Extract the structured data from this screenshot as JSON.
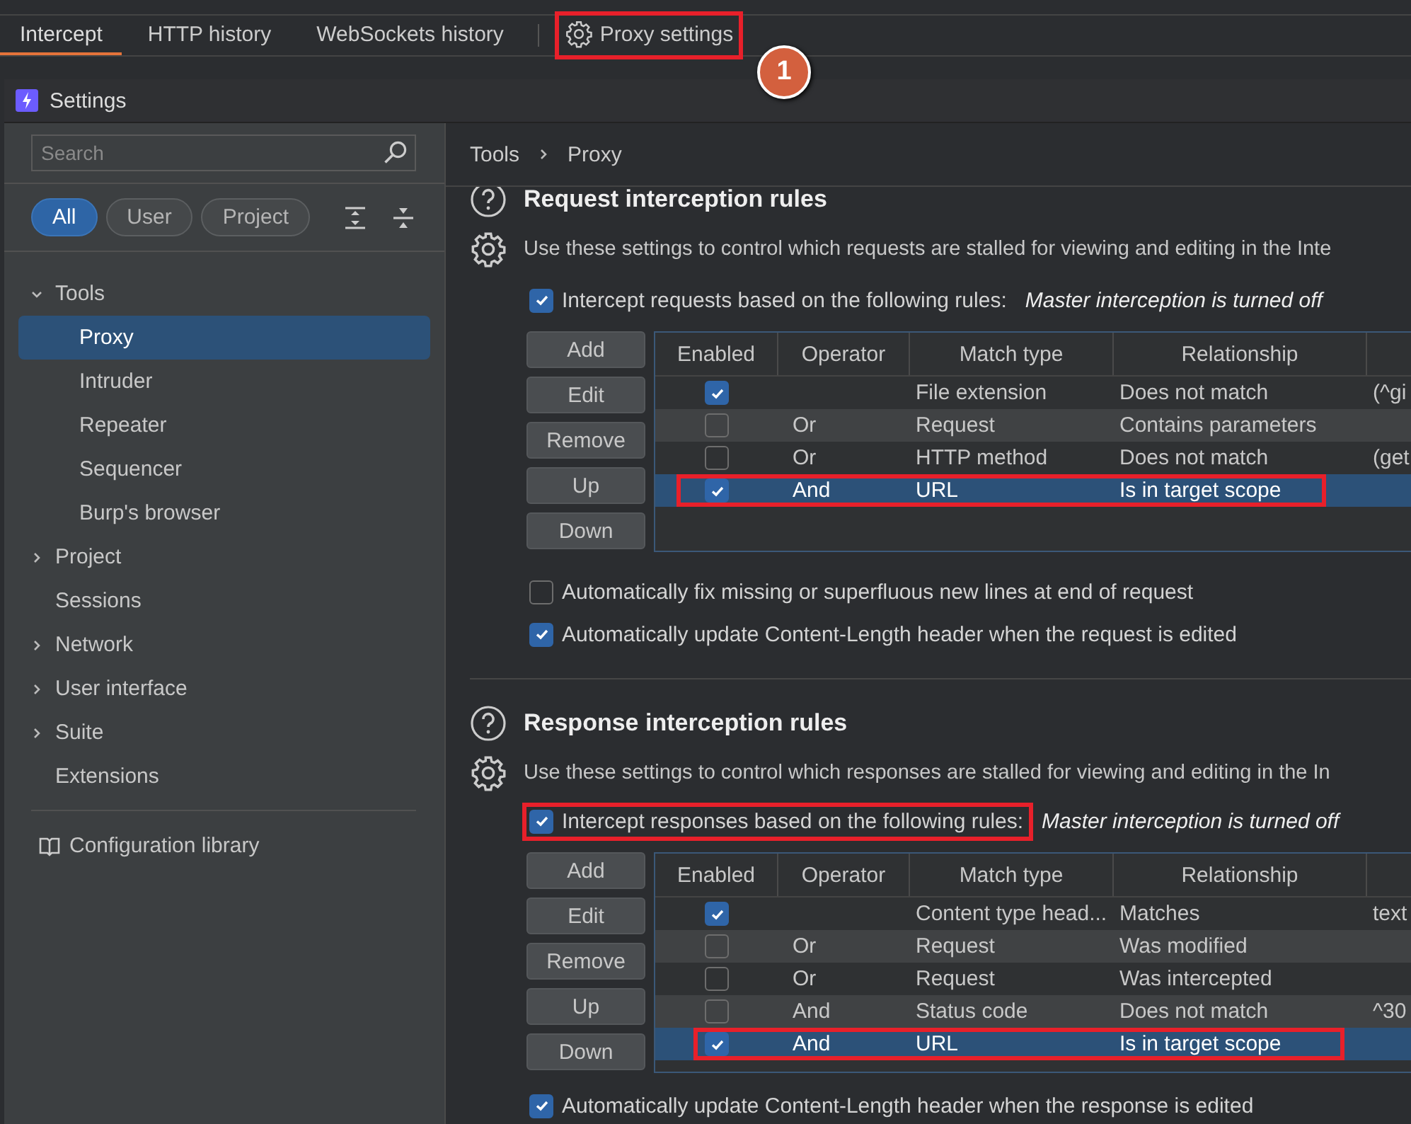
{
  "top_tabs": [
    {
      "label": "Intercept",
      "selected": true,
      "highlighted": false
    },
    {
      "label": "HTTP history",
      "selected": false,
      "highlighted": false
    },
    {
      "label": "WebSockets history",
      "selected": false,
      "highlighted": false
    },
    {
      "label": "Proxy settings",
      "selected": false,
      "highlighted": true,
      "kind": "settings"
    }
  ],
  "callout_badge": "1",
  "window": {
    "title": "Settings"
  },
  "sidebar": {
    "search": {
      "placeholder": "Search"
    },
    "filters": [
      {
        "label": "All",
        "selected": true
      },
      {
        "label": "User",
        "selected": false
      },
      {
        "label": "Project",
        "selected": false
      }
    ],
    "tree": [
      {
        "label": "Tools",
        "expanded": true,
        "selected": false,
        "children": [
          {
            "label": "Proxy",
            "selected": true
          },
          {
            "label": "Intruder",
            "selected": false
          },
          {
            "label": "Repeater",
            "selected": false
          },
          {
            "label": "Sequencer",
            "selected": false
          },
          {
            "label": "Burp's browser",
            "selected": false
          }
        ]
      },
      {
        "label": "Project",
        "expanded": false,
        "selected": false
      },
      {
        "label": "Sessions",
        "selected": false
      },
      {
        "label": "Network",
        "expanded": false,
        "selected": false
      },
      {
        "label": "User interface",
        "expanded": false,
        "selected": false
      },
      {
        "label": "Suite",
        "expanded": false,
        "selected": false
      },
      {
        "label": "Extensions",
        "selected": false
      }
    ],
    "footer_link": "Configuration library"
  },
  "breadcrumb": [
    "Tools",
    "Proxy"
  ],
  "sections": [
    {
      "title": "Request interception rules",
      "description": "Use these settings to control which requests are stalled for viewing and editing in the Inte",
      "intercept_toggle": {
        "label": "Intercept requests based on the following rules:",
        "note": "Master interception is turned off",
        "checked": true,
        "highlighted": false
      },
      "buttons": [
        "Add",
        "Edit",
        "Remove",
        "Up",
        "Down"
      ],
      "table": {
        "columns": [
          "Enabled",
          "Operator",
          "Match type",
          "Relationship"
        ],
        "rows": [
          {
            "enabled": true,
            "match_type": "File extension",
            "relationship": "Does not match",
            "column_5": "(^gi",
            "selected": false,
            "highlighted": false
          },
          {
            "enabled": false,
            "operator": "Or",
            "match_type": "Request",
            "relationship": "Contains parameters",
            "selected": false,
            "highlighted": false
          },
          {
            "enabled": false,
            "operator": "Or",
            "match_type": "HTTP method",
            "relationship": "Does not match",
            "column_5": "(get",
            "selected": false,
            "highlighted": false
          },
          {
            "enabled": true,
            "operator": "And",
            "match_type": "URL",
            "relationship": "Is in target scope",
            "selected": true,
            "highlighted": true
          }
        ]
      },
      "options": [
        {
          "label": "Automatically fix missing or superfluous new lines at end of request",
          "checked": false
        },
        {
          "label": "Automatically update Content-Length header when the request is edited",
          "checked": true
        }
      ]
    },
    {
      "title": "Response interception rules",
      "description": "Use these settings to control which responses are stalled for viewing and editing in the In",
      "intercept_toggle": {
        "label": "Intercept responses based on the following rules:",
        "note": "Master interception is turned off",
        "checked": true,
        "highlighted": true
      },
      "buttons": [
        "Add",
        "Edit",
        "Remove",
        "Up",
        "Down"
      ],
      "table": {
        "columns": [
          "Enabled",
          "Operator",
          "Match type",
          "Relationship"
        ],
        "rows": [
          {
            "enabled": true,
            "match_type": "Content type head...",
            "relationship": "Matches",
            "column_5": "text",
            "selected": false,
            "highlighted": false
          },
          {
            "enabled": false,
            "operator": "Or",
            "match_type": "Request",
            "relationship": "Was modified",
            "selected": false,
            "highlighted": false
          },
          {
            "enabled": false,
            "operator": "Or",
            "match_type": "Request",
            "relationship": "Was intercepted",
            "selected": false,
            "highlighted": false
          },
          {
            "enabled": false,
            "operator": "And",
            "match_type": "Status code",
            "relationship": "Does not match",
            "column_5": "^30",
            "selected": false,
            "highlighted": false
          },
          {
            "enabled": true,
            "operator": "And",
            "match_type": "URL",
            "relationship": "Is in target scope",
            "selected": true,
            "highlighted": true
          }
        ]
      },
      "options": [
        {
          "label": "Automatically update Content-Length header when the response is edited",
          "checked": true
        }
      ]
    }
  ]
}
